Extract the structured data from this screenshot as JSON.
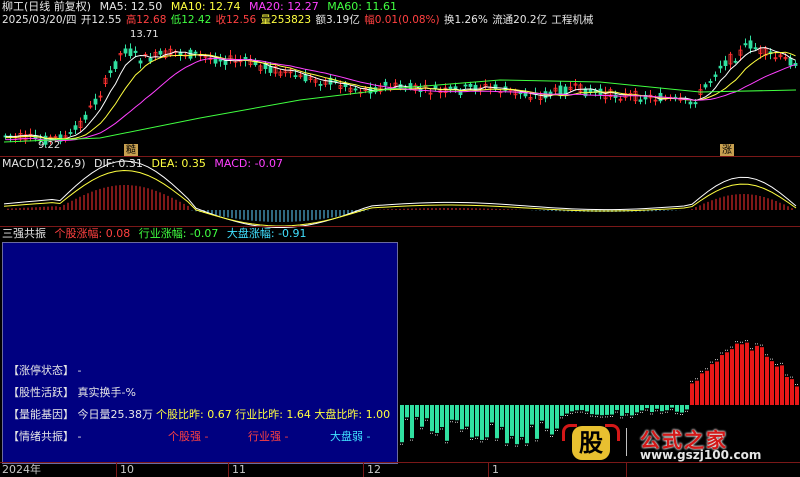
{
  "header": {
    "name": "柳工(日线 前复权)",
    "ma5": "MA5: 12.50",
    "ma10": "MA10: 12.74",
    "ma20": "MA20: 12.27",
    "ma60": "MA60: 11.61"
  },
  "quote": {
    "date": "2025/03/20/四",
    "open": "开12.55",
    "high": "高12.68",
    "low": "低12.42",
    "close": "收12.56",
    "volume": "量253823",
    "amount": "额3.19亿",
    "change": "幅0.01(0.08%)",
    "turnover": "换1.26%",
    "float_cap": "流通20.2亿",
    "industry": "工程机械"
  },
  "price_panel": {
    "high_label": "13.71",
    "low_label": "9.22",
    "marker_left": "糙",
    "marker_right": "涨"
  },
  "macd": {
    "title": "MACD(12,26,9)",
    "dif": "DIF: 0.31",
    "dea": "DEA: 0.35",
    "macd": "MACD: -0.07"
  },
  "resonance": {
    "title": "三强共振",
    "stock_label": "个股涨幅: 0.08",
    "industry_label": "行业涨幅: -0.07",
    "market_label": "大盘涨幅: -0.91"
  },
  "info": {
    "limit_status": "【涨停状态】 -",
    "activity": "【股性活跃】 真实换手-%",
    "volume_gene": "【量能基因】 今日量25.38万",
    "ratios": "个股比昨: 0.67  行业比昨: 1.64  大盘比昨: 1.00",
    "sentiment": "【情绪共振】 -",
    "stock_strong": "个股强 -",
    "industry_strong": "行业强 -",
    "market_weak": "大盘弱 -"
  },
  "axis": {
    "dates": [
      "2024年",
      "10",
      "11",
      "12",
      "1",
      "2"
    ]
  },
  "watermark": {
    "logo_char": "股",
    "brand": "公式之家",
    "url": "www.gszj100.com"
  },
  "colors": {
    "up": "#ff3030",
    "down": "#30e0a0",
    "ma5": "#ffffff",
    "ma10": "#ffff40",
    "ma20": "#ff40ff",
    "ma60": "#40ff40",
    "panel_bg": "#000080"
  }
}
